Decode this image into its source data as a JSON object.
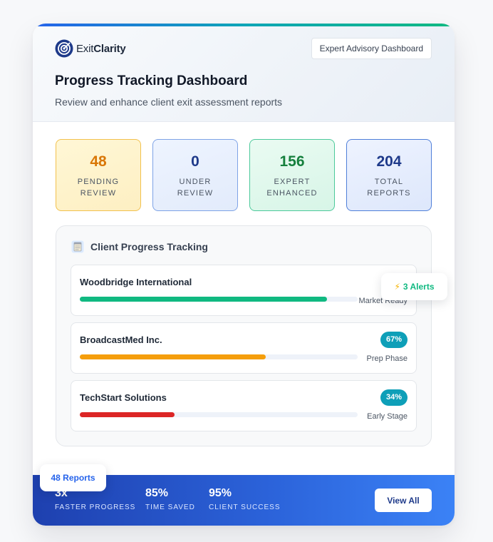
{
  "brand": {
    "prefix": "Exit",
    "name": "Clarity"
  },
  "header": {
    "button_label": "Expert Advisory Dashboard",
    "title": "Progress Tracking Dashboard",
    "subtitle": "Review and enhance client exit assessment reports"
  },
  "stats": [
    {
      "value": "48",
      "label": "PENDING REVIEW",
      "color": "#d97706"
    },
    {
      "value": "0",
      "label": "UNDER REVIEW",
      "color": "#1e3a8a"
    },
    {
      "value": "156",
      "label": "EXPERT ENHANCED",
      "color": "#15803d"
    },
    {
      "value": "204",
      "label": "TOTAL REPORTS",
      "color": "#1e3a8a"
    }
  ],
  "tracking": {
    "icon": "clipboard-icon",
    "title": "Client Progress Tracking",
    "clients": [
      {
        "name": "Woodbridge International",
        "progress": 0.89,
        "percent_label": "",
        "stage": "Market Ready",
        "bar_color": "#10b981"
      },
      {
        "name": "BroadcastMed Inc.",
        "progress": 0.67,
        "percent_label": "67%",
        "stage": "Prep Phase",
        "bar_color": "#f59e0b"
      },
      {
        "name": "TechStart Solutions",
        "progress": 0.34,
        "percent_label": "34%",
        "stage": "Early Stage",
        "bar_color": "#dc2626"
      }
    ]
  },
  "floating": {
    "alerts_label": "3 Alerts",
    "alerts_icon": "lightning-icon",
    "reports_label": "48 Reports"
  },
  "footer": {
    "metrics": [
      {
        "value": "3x",
        "label": "FASTER PROGRESS"
      },
      {
        "value": "85%",
        "label": "TIME SAVED"
      },
      {
        "value": "95%",
        "label": "CLIENT SUCCESS"
      }
    ],
    "button_label": "View All"
  },
  "colors": {
    "accent": "#2563eb",
    "teal": "#0e9fb8",
    "green": "#10b981"
  }
}
